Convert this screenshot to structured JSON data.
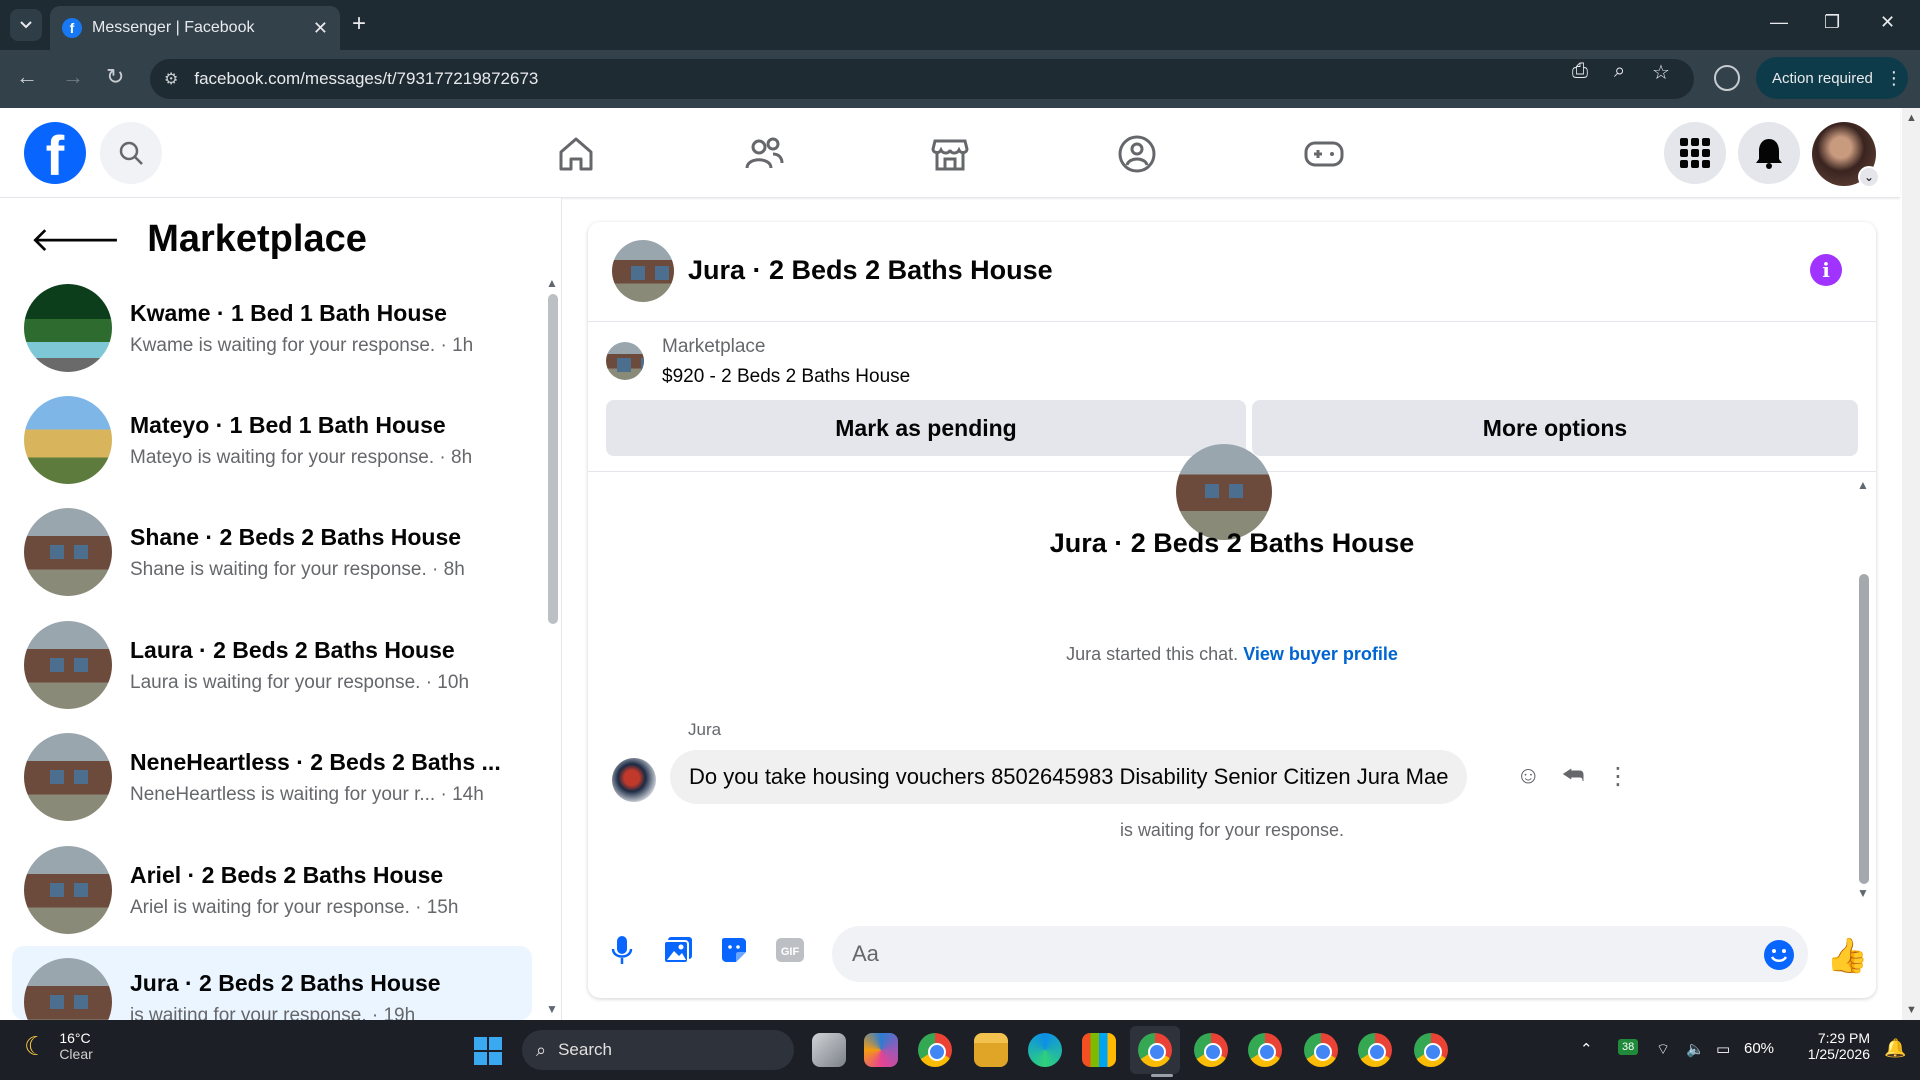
{
  "browser": {
    "tab_title": "Messenger | Facebook",
    "url": "facebook.com/messages/t/793177219872673",
    "action_required": "Action required"
  },
  "fb": {
    "icons": [
      "home-icon",
      "friends-icon",
      "marketplace-icon",
      "groups-icon",
      "gaming-icon",
      "menu-grid-icon",
      "notifications-icon"
    ]
  },
  "sidebar": {
    "title": "Marketplace",
    "conversations": [
      {
        "name": "Kwame · 1 Bed 1 Bath House",
        "sub": "Kwame is waiting for your response. · 1h"
      },
      {
        "name": "Mateyo · 1 Bed 1 Bath House",
        "sub": "Mateyo is waiting for your response. · 8h"
      },
      {
        "name": "Shane · 2 Beds 2 Baths House",
        "sub": "Shane is waiting for your response. · 8h"
      },
      {
        "name": "Laura · 2 Beds 2 Baths House",
        "sub": "Laura is waiting for your response. · 10h"
      },
      {
        "name": "NeneHeartless · 2 Beds 2 Baths ...",
        "sub": "NeneHeartless is waiting for your r... · 14h"
      },
      {
        "name": "Ariel · 2 Beds 2 Baths House",
        "sub": "Ariel is waiting for your response. · 15h"
      },
      {
        "name": "Jura · 2 Beds 2 Baths House",
        "sub": "is waiting for your response. · 19h"
      }
    ]
  },
  "chat": {
    "title": "Jura · 2 Beds 2 Baths House",
    "listing_source": "Marketplace",
    "listing_price": "$920 - 2 Beds 2 Baths House",
    "mark_pending": "Mark as pending",
    "more_options": "More options",
    "center_title": "Jura · 2 Beds 2 Baths House",
    "started_text": "Jura started this chat.",
    "view_buyer": "View buyer profile",
    "sender": "Jura",
    "message": "Do you take housing vouchers 8502645983 Disability Senior Citizen Jura Mae",
    "waiting": "is waiting for your response.",
    "composer_placeholder": "Aa"
  },
  "taskbar": {
    "temp": "16°C",
    "condition": "Clear",
    "search": "Search",
    "badge": "38",
    "battery": "60%",
    "time": "7:29 PM",
    "date": "1/25/2026"
  }
}
